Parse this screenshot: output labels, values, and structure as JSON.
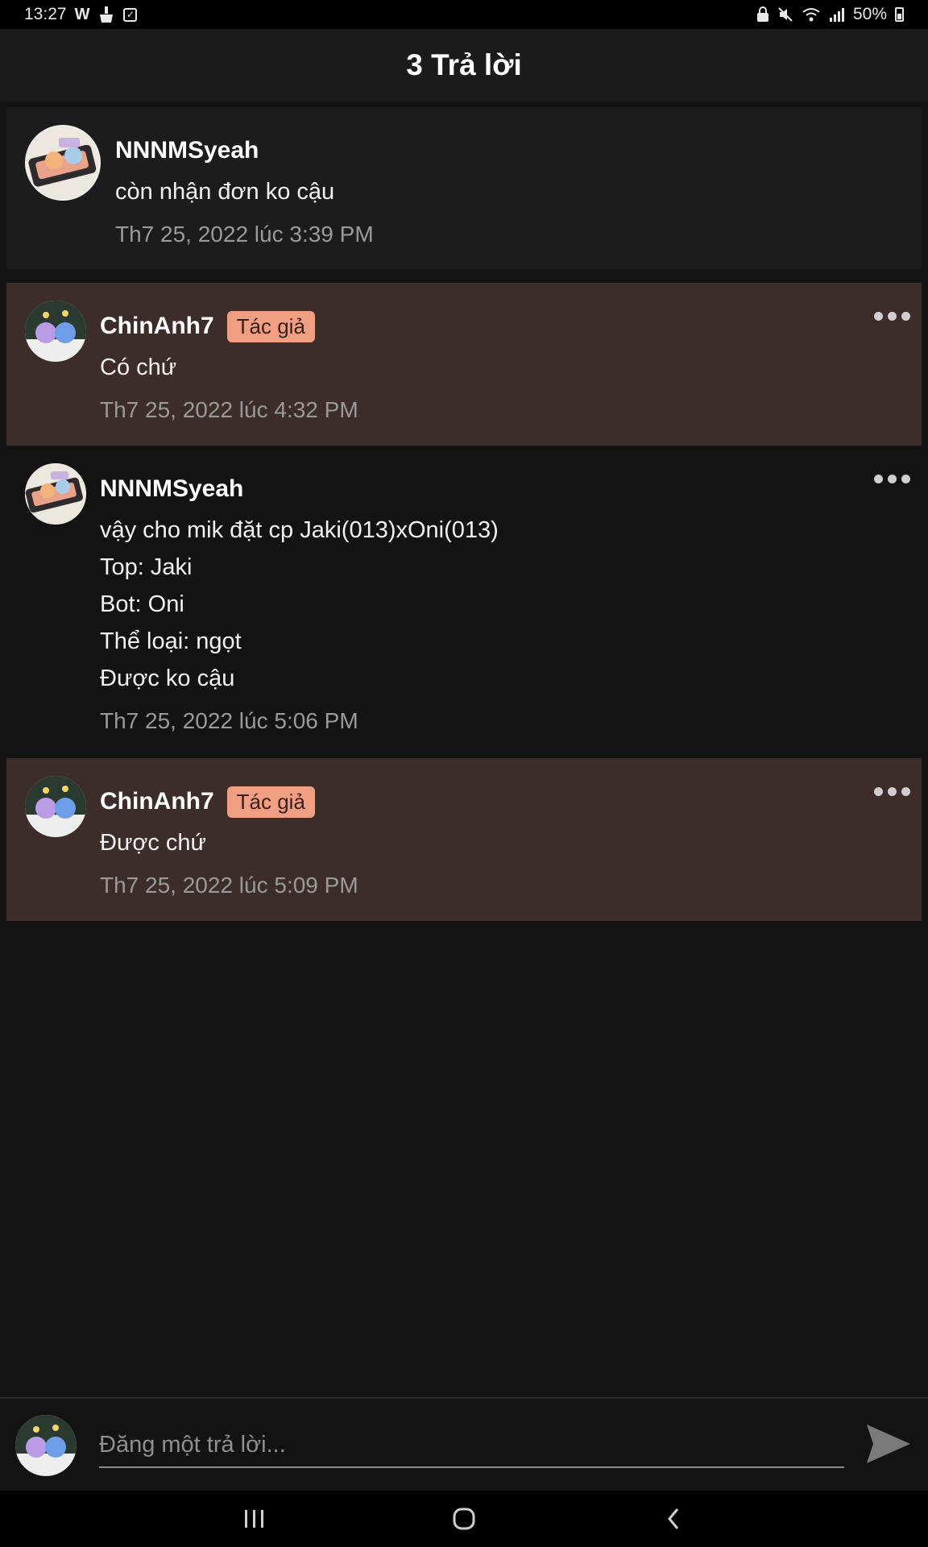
{
  "status_bar": {
    "time": "13:27",
    "left_icons": [
      "w-app-icon",
      "broom-icon",
      "checkbox-icon"
    ],
    "right_icons": [
      "lock-icon",
      "mute-icon",
      "wifi-icon",
      "signal-icon"
    ],
    "battery": "50%"
  },
  "header": {
    "title": "3 Trả lời"
  },
  "comments": [
    {
      "username": "NNNMSyeah",
      "badge": "",
      "lines": [
        "còn nhận đơn ko cậu"
      ],
      "timestamp": "Th7 25, 2022 lúc 3:39 PM"
    },
    {
      "username": "ChinAnh7",
      "badge": "Tác giả",
      "lines": [
        "Có chứ"
      ],
      "timestamp": "Th7 25, 2022 lúc 4:32 PM"
    },
    {
      "username": "NNNMSyeah",
      "badge": "",
      "lines": [
        "vậy cho mik đặt cp Jaki(013)xOni(013)",
        "Top: Jaki",
        "Bot: Oni",
        "Thể loại: ngọt",
        "Được ko cậu"
      ],
      "timestamp": "Th7 25, 2022 lúc 5:06 PM"
    },
    {
      "username": "ChinAnh7",
      "badge": "Tác giả",
      "lines": [
        "Được chứ"
      ],
      "timestamp": "Th7 25, 2022 lúc 5:09 PM"
    }
  ],
  "composer": {
    "placeholder": "Đăng một trả lời..."
  },
  "colors": {
    "background": "#131313",
    "author_row": "#3c2c2a",
    "badge": "#f19f83"
  }
}
